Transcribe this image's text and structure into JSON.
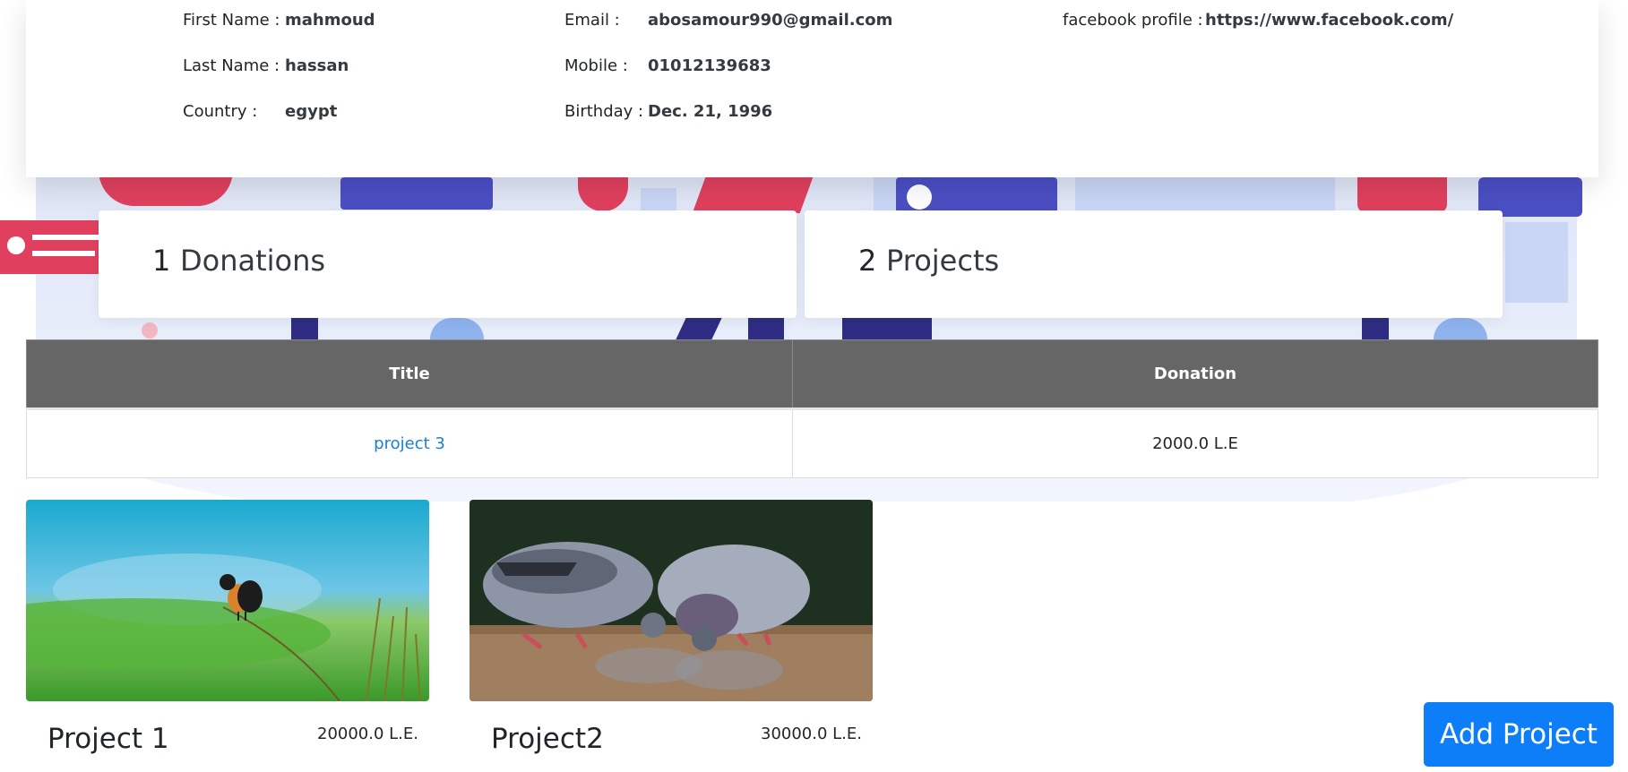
{
  "profile": {
    "first_name_label": "First Name :",
    "first_name": "mahmoud",
    "last_name_label": "Last Name :",
    "last_name": "hassan",
    "country_label": "Country :",
    "country": "egypt",
    "email_label": "Email :",
    "email": "abosamour990@gmail.com",
    "mobile_label": "Mobile :",
    "mobile": "01012139683",
    "birthday_label": "Birthday :",
    "birthday": "Dec. 21, 1996",
    "facebook_label": "facebook profile :",
    "facebook": "https://www.facebook.com/"
  },
  "stats": {
    "donations_count": "1",
    "donations_label": "Donations",
    "projects_count": "2",
    "projects_label": "Projects"
  },
  "donations_table": {
    "headers": [
      "Title",
      "Donation"
    ],
    "rows": [
      {
        "title": "project 3",
        "donation": "2000.0 L.E"
      }
    ]
  },
  "projects": [
    {
      "name": "Project 1",
      "amount": "20000.0 L.E.",
      "image": "bird-on-grass"
    },
    {
      "name": "Project2",
      "amount": "30000.0 L.E.",
      "image": "pigeons-drinking"
    }
  ],
  "actions": {
    "add_project_label": "Add Project"
  },
  "colors": {
    "table_header": "#666666",
    "link": "#1a7fd6",
    "primary_button": "#0d7ef8",
    "accent_pink": "#e0405e",
    "accent_navy": "#2e2d83"
  }
}
